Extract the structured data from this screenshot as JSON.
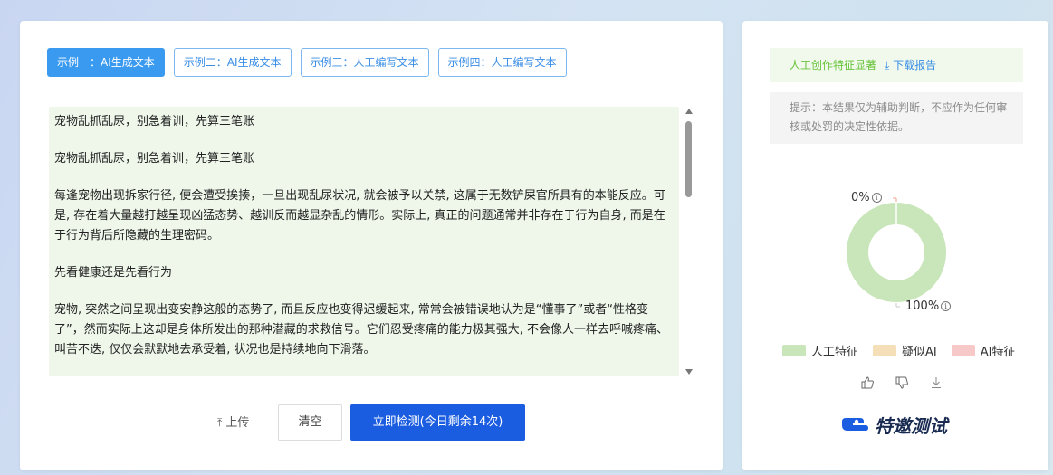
{
  "tabs": [
    {
      "label": "示例一：AI生成文本",
      "active": true
    },
    {
      "label": "示例二：AI生成文本",
      "active": false
    },
    {
      "label": "示例三：人工编写文本",
      "active": false
    },
    {
      "label": "示例四：人工编写文本",
      "active": false
    }
  ],
  "text": {
    "paragraphs": [
      "宠物乱抓乱尿，别急着训，先算三笔账",
      "宠物乱抓乱尿，别急着训，先算三笔账",
      "每逢宠物出现拆家行径, 便会遭受挨揍，一旦出现乱尿状况, 就会被予以关禁, 这属于无数铲屎官所具有的本能反应。可是, 存在着大量越打越呈现凶猛态势、越训反而越显杂乱的情形。实际上, 真正的问题通常并非存在于行为自身, 而是在于行为背后所隐藏的生理密码。",
      "先看健康还是先看行为",
      "宠物, 突然之间呈现出变安静这般的态势了, 而且反应也变得迟缓起来, 常常会被错误地认为是“懂事了”或者“性格变了”，然而实际上这却是身体所发出的那种潜藏的求救信号。它们忍受疼痛的能力极其强大, 不会像人一样去呼喊疼痛、叫苦不迭, 仅仅会默默地去承受着, 状况也是持续地向下滑落。"
    ]
  },
  "actions": {
    "upload_label": "上传",
    "clear_label": "清空",
    "detect_label": "立即检测(今日剩余14次)"
  },
  "result": {
    "summary": "人工创作特征显著",
    "download_label": "下载报告",
    "notice": "提示：本结果仅为辅助判断，不应作为任何审核或处罚的决定性依据。",
    "close_symbol": "×"
  },
  "chart_data": {
    "type": "pie",
    "donut": true,
    "slices": [
      {
        "name": "人工特征",
        "value": 100,
        "color": "#c8e6b9"
      },
      {
        "name": "疑似AI",
        "value": 0,
        "color": "#f5dfb8"
      },
      {
        "name": "AI特征",
        "value": 0,
        "color": "#f7c8c8"
      }
    ],
    "labels": {
      "top": "0%",
      "bottom": "100%"
    }
  },
  "legend": [
    {
      "label": "人工特征",
      "color": "#c8e6b9"
    },
    {
      "label": "疑似AI",
      "color": "#f5dfb8"
    },
    {
      "label": "AI特征",
      "color": "#f7c8c8"
    }
  ],
  "brand": {
    "label": "特邀测试"
  }
}
